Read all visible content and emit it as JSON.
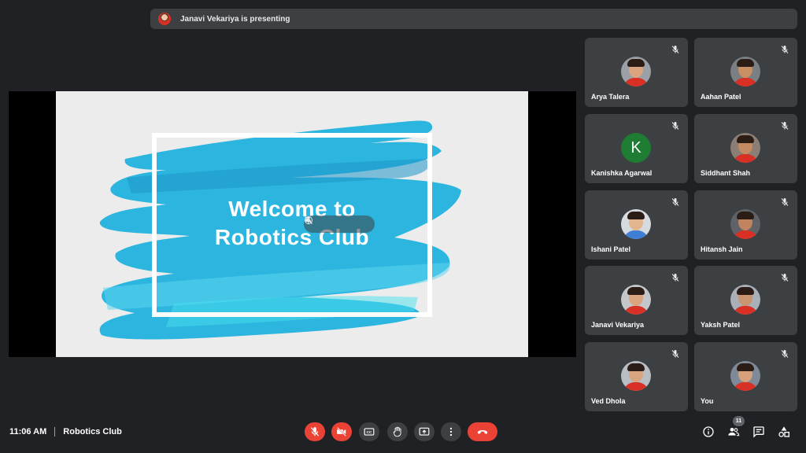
{
  "presenting": {
    "text": "Janavi Vekariya is presenting",
    "avatar_icon": "presenter-avatar"
  },
  "slide": {
    "title_line1": "Welcome to",
    "title_line2": "Robotics Club",
    "brush_color": "#29b6e3"
  },
  "participants": [
    {
      "name": "Arya Talera",
      "avatar": "photo",
      "muted": true
    },
    {
      "name": "Aahan Patel",
      "avatar": "photo",
      "muted": true
    },
    {
      "name": "Kanishka Agarwal",
      "avatar": "letter",
      "letter": "K",
      "muted": true
    },
    {
      "name": "Siddhant Shah",
      "avatar": "photo",
      "muted": true
    },
    {
      "name": "Ishani Patel",
      "avatar": "photo",
      "muted": true
    },
    {
      "name": "Hitansh Jain",
      "avatar": "photo",
      "muted": true
    },
    {
      "name": "Janavi Vekariya",
      "avatar": "photo",
      "muted": true
    },
    {
      "name": "Yaksh Patel",
      "avatar": "photo",
      "muted": true
    },
    {
      "name": "Ved Dhola",
      "avatar": "photo",
      "muted": true
    },
    {
      "name": "You",
      "avatar": "photo",
      "muted": true
    }
  ],
  "footer": {
    "time": "11:06 AM",
    "meeting_name": "Robotics Club"
  },
  "controls": {
    "mic": "mic-off-icon",
    "camera": "camera-off-icon",
    "captions": "captions-icon",
    "raise_hand": "raise-hand-icon",
    "present": "present-screen-icon",
    "more": "more-options-icon",
    "hangup": "hang-up-icon"
  },
  "right_controls": {
    "people_count": "11"
  },
  "colors": {
    "background": "#202124",
    "tile": "#3c4043",
    "danger": "#ea4335"
  }
}
